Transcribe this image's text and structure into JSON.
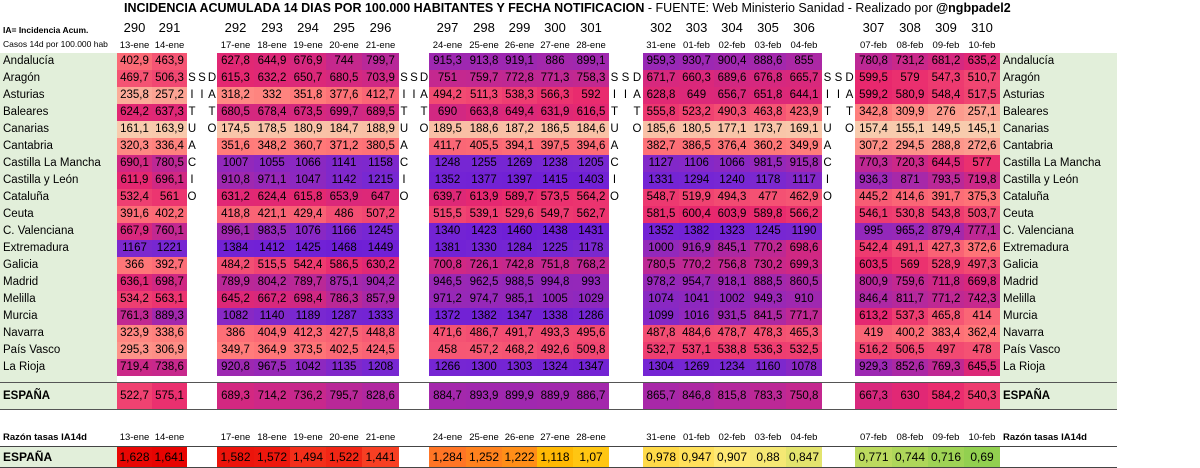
{
  "title": {
    "bold": "INCIDENCIA ACUMULADA 14 DIAS POR 100.000 HABITANTES Y FECHA NOTIFICACION",
    "rest": " - FUENTE: Web Ministerio Sanidad - Realizado por ",
    "handle": "@ngbpadel2"
  },
  "notes": {
    "ia": "IA= Incidencia Acum.",
    "casos": "Casos 14d  por 100.000 hab"
  },
  "day_numbers": [
    "290",
    "291",
    "292",
    "293",
    "294",
    "295",
    "296",
    "297",
    "298",
    "299",
    "300",
    "301",
    "302",
    "303",
    "304",
    "305",
    "306",
    "307",
    "308",
    "309",
    "310"
  ],
  "dates": [
    "13-ene",
    "14-ene",
    "17-ene",
    "18-ene",
    "19-ene",
    "20-ene",
    "21-ene",
    "24-ene",
    "25-ene",
    "26-ene",
    "27-ene",
    "28-ene",
    "31-ene",
    "01-feb",
    "02-feb",
    "03-feb",
    "04-feb",
    "07-feb",
    "08-feb",
    "09-feb",
    "10-feb"
  ],
  "separators": [
    "SITUACION",
    "SIN",
    "DATOS",
    "NO"
  ],
  "regions": [
    {
      "name": "Andalucía",
      "values": [
        "402,9",
        "463,9",
        "627,8",
        "644,9",
        "676,9",
        "744",
        "799,7",
        "915,3",
        "913,8",
        "919,1",
        "886",
        "899,1",
        "959,3",
        "930,7",
        "900,4",
        "888,6",
        "855",
        "780,8",
        "731,2",
        "681,2",
        "635,2"
      ]
    },
    {
      "name": "Aragón",
      "values": [
        "469,7",
        "506,3",
        "615,3",
        "632,2",
        "650,7",
        "680,5",
        "703,9",
        "751",
        "759,7",
        "772,8",
        "771,3",
        "758,3",
        "671,7",
        "660,3",
        "689,6",
        "676,8",
        "665,7",
        "599,5",
        "579",
        "547,3",
        "510,7"
      ]
    },
    {
      "name": "Asturias",
      "values": [
        "235,8",
        "257,2",
        "318,2",
        "332",
        "351,8",
        "377,6",
        "412,7",
        "494,2",
        "511,3",
        "538,3",
        "566,3",
        "592",
        "628,8",
        "649",
        "656,7",
        "651,8",
        "644,1",
        "599,2",
        "580,9",
        "548,4",
        "517,5"
      ]
    },
    {
      "name": "Baleares",
      "values": [
        "624,2",
        "637,3",
        "680,5",
        "678,4",
        "673,5",
        "699,7",
        "689,5",
        "690",
        "663,8",
        "649,4",
        "631,9",
        "616,5",
        "555,8",
        "523,2",
        "490,3",
        "463,8",
        "423,9",
        "342,8",
        "309,9",
        "276",
        "257,1"
      ]
    },
    {
      "name": "Canarias",
      "values": [
        "161,1",
        "163,9",
        "174,5",
        "178,5",
        "180,9",
        "184,7",
        "188,9",
        "189,5",
        "188,6",
        "187,2",
        "186,5",
        "184,6",
        "185,6",
        "180,5",
        "177,1",
        "173,7",
        "169,1",
        "157,4",
        "155,1",
        "149,5",
        "145,1"
      ]
    },
    {
      "name": "Cantabria",
      "values": [
        "320,3",
        "336,4",
        "351,6",
        "348,2",
        "360,7",
        "371,2",
        "380,5",
        "411,7",
        "405,5",
        "394,1",
        "397,5",
        "394,6",
        "382,7",
        "386,5",
        "376,4",
        "360,2",
        "349,9",
        "307,2",
        "294,5",
        "288,8",
        "272,6"
      ]
    },
    {
      "name": "Castilla La Mancha",
      "values": [
        "690,1",
        "780,5",
        "1007",
        "1055",
        "1066",
        "1141",
        "1158",
        "1248",
        "1255",
        "1269",
        "1238",
        "1205",
        "1127",
        "1106",
        "1066",
        "981,5",
        "915,8",
        "770,3",
        "720,3",
        "644,5",
        "577"
      ]
    },
    {
      "name": "Castilla y León",
      "values": [
        "611,9",
        "696,1",
        "910,8",
        "971,1",
        "1047",
        "1142",
        "1215",
        "1352",
        "1377",
        "1397",
        "1415",
        "1403",
        "1331",
        "1294",
        "1240",
        "1178",
        "1117",
        "936,3",
        "871",
        "793,5",
        "719,8"
      ]
    },
    {
      "name": "Cataluña",
      "values": [
        "532,4",
        "561",
        "631,2",
        "624,4",
        "615,8",
        "653,9",
        "647",
        "639,7",
        "613,9",
        "589,7",
        "573,5",
        "564,2",
        "548,7",
        "519,9",
        "494,3",
        "477",
        "462,9",
        "445,2",
        "414,6",
        "391,7",
        "375,3"
      ]
    },
    {
      "name": "Ceuta",
      "values": [
        "391,6",
        "402,2",
        "418,8",
        "421,1",
        "429,4",
        "486",
        "507,2",
        "515,5",
        "539,1",
        "529,6",
        "549,7",
        "562,7",
        "581,5",
        "600,4",
        "603,9",
        "589,8",
        "566,2",
        "546,1",
        "530,8",
        "543,8",
        "503,7"
      ]
    },
    {
      "name": "C. Valenciana",
      "values": [
        "667,9",
        "760,1",
        "896,1",
        "983,5",
        "1076",
        "1166",
        "1245",
        "1340",
        "1423",
        "1460",
        "1438",
        "1431",
        "1352",
        "1382",
        "1323",
        "1245",
        "1190",
        "995",
        "965,2",
        "879,4",
        "777,1"
      ]
    },
    {
      "name": "Extremadura",
      "values": [
        "1167",
        "1221",
        "1384",
        "1412",
        "1425",
        "1468",
        "1449",
        "1381",
        "1330",
        "1284",
        "1225",
        "1178",
        "1000",
        "916,9",
        "845,1",
        "770,2",
        "698,6",
        "542,4",
        "491,1",
        "427,3",
        "372,6"
      ]
    },
    {
      "name": "Galicia",
      "values": [
        "366",
        "392,7",
        "484,2",
        "515,5",
        "542,4",
        "586,5",
        "630,2",
        "700,8",
        "726,1",
        "742,8",
        "751,8",
        "768,2",
        "780,5",
        "770,2",
        "756,8",
        "730,2",
        "699,3",
        "603,5",
        "569",
        "528,9",
        "497,3"
      ]
    },
    {
      "name": "Madrid",
      "values": [
        "636,1",
        "698,7",
        "789,9",
        "804,2",
        "789,7",
        "875,1",
        "904,2",
        "946,5",
        "962,5",
        "988,5",
        "994,8",
        "993",
        "978,2",
        "954,7",
        "918,1",
        "888,5",
        "860,5",
        "800,9",
        "759,6",
        "711,8",
        "669,8"
      ]
    },
    {
      "name": "Melilla",
      "values": [
        "534,2",
        "563,1",
        "645,2",
        "667,2",
        "698,4",
        "786,3",
        "857,9",
        "971,2",
        "974,7",
        "985,1",
        "1005",
        "1029",
        "1074",
        "1041",
        "1002",
        "949,3",
        "910",
        "846,4",
        "811,7",
        "771,2",
        "742,3"
      ]
    },
    {
      "name": "Murcia",
      "values": [
        "761,3",
        "889,3",
        "1082",
        "1140",
        "1189",
        "1287",
        "1333",
        "1372",
        "1382",
        "1347",
        "1338",
        "1286",
        "1099",
        "1016",
        "931,5",
        "841,5",
        "771,7",
        "613,2",
        "537,3",
        "465,8",
        "414"
      ]
    },
    {
      "name": "Navarra",
      "values": [
        "323,9",
        "338,6",
        "386",
        "404,9",
        "412,3",
        "427,5",
        "448,8",
        "471,6",
        "486,7",
        "491,7",
        "493,3",
        "495,6",
        "487,8",
        "484,6",
        "478,7",
        "478,3",
        "465,3",
        "419",
        "400,2",
        "383,4",
        "362,4"
      ]
    },
    {
      "name": "País Vasco",
      "values": [
        "295,3",
        "306,9",
        "349,7",
        "364,9",
        "373,5",
        "402,5",
        "424,5",
        "458",
        "457,2",
        "468,2",
        "492,6",
        "509,8",
        "532,7",
        "537,1",
        "538,8",
        "536,3",
        "532,5",
        "516,2",
        "506,5",
        "497",
        "478"
      ]
    },
    {
      "name": "La Rioja",
      "values": [
        "719,4",
        "738,6",
        "920,8",
        "967,5",
        "1042",
        "1135",
        "1208",
        "1266",
        "1300",
        "1303",
        "1324",
        "1347",
        "1304",
        "1269",
        "1234",
        "1160",
        "1078",
        "929,3",
        "852,6",
        "769,3",
        "645,5"
      ]
    }
  ],
  "spain": {
    "name": "ESPAÑA",
    "values": [
      "522,7",
      "575,1",
      "689,3",
      "714,2",
      "736,2",
      "795,7",
      "828,6",
      "884,7",
      "893,9",
      "899,9",
      "889,9",
      "886,7",
      "865,7",
      "846,8",
      "815,8",
      "783,3",
      "750,8",
      "667,3",
      "630",
      "584,2",
      "540,3"
    ]
  },
  "ratio": {
    "label": "Razón tasas IA14d",
    "name": "ESPAÑA",
    "values": [
      "1,628",
      "1,641",
      "1,582",
      "1,572",
      "1,494",
      "1,522",
      "1,441",
      "1,284",
      "1,252",
      "1,222",
      "1,118",
      "1,07",
      "0,978",
      "0,947",
      "0,907",
      "0,88",
      "0,847",
      "0,771",
      "0,744",
      "0,716",
      "0,69"
    ]
  }
}
